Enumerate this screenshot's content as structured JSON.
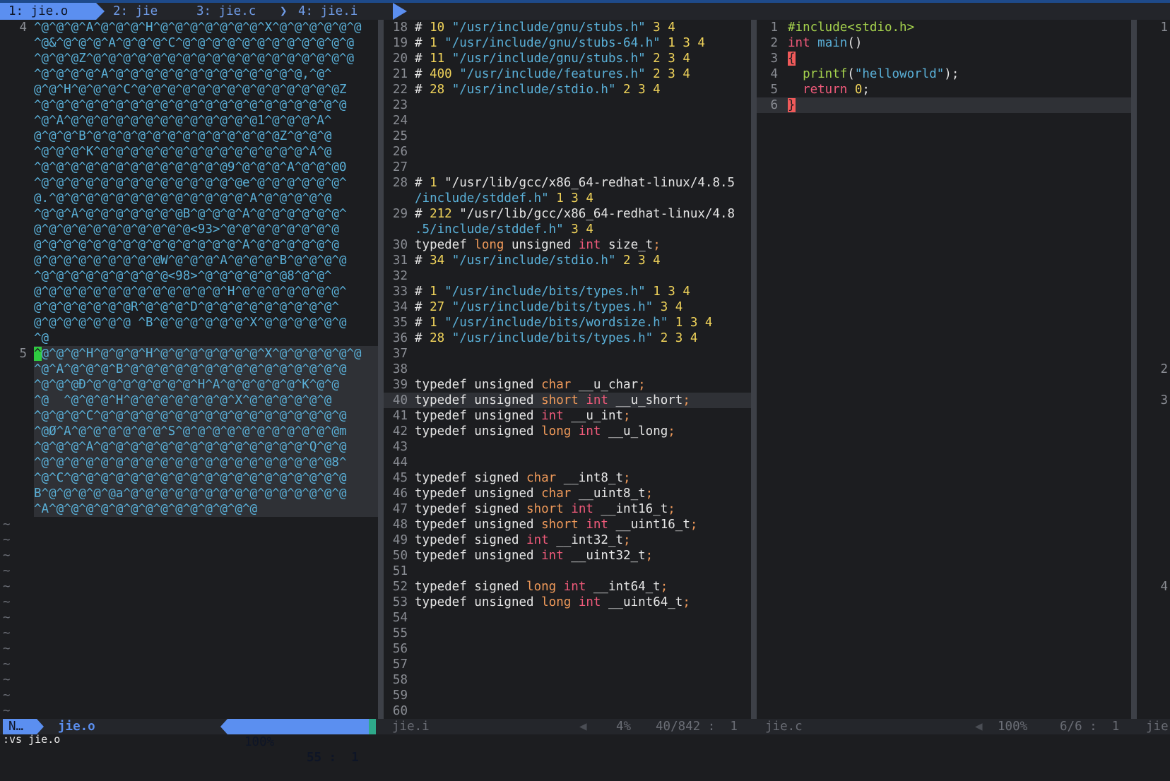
{
  "tabline": {
    "tabs": [
      {
        "label": "1: jie.o",
        "active": true
      },
      {
        "label": "2: jie",
        "active": false
      },
      {
        "label": "3: jie.c",
        "active": false
      },
      {
        "label": "4: jie.i",
        "active": false
      }
    ]
  },
  "pane_left": {
    "filename": "jie.o",
    "line4_num": "4",
    "line5_num": "5",
    "line4_text": [
      "^@^@^@^A^@^@^@^H^@^@^@^@^@^@^@^X^@^@^@^@^@^@",
      "^@&^@^@^@^A^@^@^@^C^@^@^@^@^@^@^@^@^@^@^@^@",
      "^@^@^@Z^@^@^@^@^@^@^@^@^@^@^@^@^@^@^@^@^@^@",
      "^@^@^@^@^A^@^@^@^@^@^@^@^@^@^@^@^@^@,^@^",
      "@^@^H^@^@^@^C^@^@^@^@^@^@^@^@^@^@^@^@^@^@Z",
      "^@^@^@^@^@^@^@^@^@^@^@^@^@^@^@^@^@^@^@^@^@",
      "^@^A^@^@^@^@^@^@^@^@^@^@^@^@^@1^@^@^@^A^",
      "@^@^@^B^@^@^@^@^@^@^@^@^@^@^@^@^@Z^@^@^@",
      "^@^@^@^K^@^@^@^@^@^@^@^@^@^@^@^@^@^@^A^@",
      "^@^@^@^@^@^@^@^@^@^@^@^@^@9^@^@^@^A^@^@^@0",
      "^@^@^@^@^@^@^@^@^@^@^@^@^@^@e^@^@^@^@^@^@^",
      "@.^@^@^@^@^@^@^@^@^@^@^@^@^@^A^@^@^@^@^@",
      "^@^@^A^@^@^@^@^@^@^@B^@^@^@^A^@^@^@^@^@^@^",
      "@^@^@^@^@^@^@^@^@^@^@<93>^@^@^@^@^@^@^@^@",
      "@^@^@^@^@^@^@^@^@^@^@^@^@^@^A^@^@^@^@^@^@",
      "@^@^@^@^@^@^@^@^@W^@^@^@^A^@^@^@^B^@^@^@^@",
      "^@^@^@^@^@^@^@^@^@<98>^@^@^@^@^@^@8^@^@^",
      "@^@^@^@^@^@^@^@^@^@^@^@^@^H^@^@^@^@^@^@^@^",
      "@^@^@^@^@^@^@R^@^@^@^D^@^@^@^@^@^@^@^@^@^",
      "@^@^@^@^@^@^@ ^B^@^@^@^@^@^@^X^@^@^@^@^@^@",
      "^@"
    ],
    "line5_text": [
      "^@^@^@^H^@^@^@^H^@^@^@^@^@^@^@^X^@^@^@^@^@^@",
      "^@^A^@^@^@^B^@^@^@^@^@^@^@^@^@^@^@^@^@^@^@",
      "^@^@^@Ð^@^@^@^@^@^@^@^H^A^@^@^@^@^@^K^@^@",
      "^@  ^@^@^@^H^@^@^@^@^@^@^@^X^@^@^@^@^@^@",
      "^@^@^@^C^@^@^@^@^@^@^@^@^@^@^@^@^@^@^@^@^@",
      "^@Ø^A^@^@^@^@^@^@^S^@^@^@^@^@^@^@^@^@^@^@m",
      "^@^@^@^A^@^@^@^@^@^@^@^@^@^@^@^@^@^@^Q^@^@",
      "^@^@^@^@^@^@^@^@^@^@^@^@^@^@^@^@^@^@^@^@8^",
      "^@^C^@^@^@^@^@^@^@^@^@^@^@^@^@^@^@^@^@^@^@",
      "B^@^@^@^@^@a^@^@^@^@^@^@^@^@^@^@^@^@^@^@^@",
      "^A^@^@^@^@^@^@^@^@^@^@^@^@^@^@"
    ],
    "tilde": "~"
  },
  "pane_mid": {
    "filename": "jie.i",
    "lines": [
      {
        "n": "18",
        "t": "# 10 \"/usr/include/gnu/stubs.h\" 3 4"
      },
      {
        "n": "19",
        "t": "# 1 \"/usr/include/gnu/stubs-64.h\" 1 3 4"
      },
      {
        "n": "20",
        "t": "# 11 \"/usr/include/gnu/stubs.h\" 2 3 4"
      },
      {
        "n": "21",
        "t": "# 400 \"/usr/include/features.h\" 2 3 4"
      },
      {
        "n": "22",
        "t": "# 28 \"/usr/include/stdio.h\" 2 3 4"
      },
      {
        "n": "23",
        "t": ""
      },
      {
        "n": "24",
        "t": ""
      },
      {
        "n": "25",
        "t": ""
      },
      {
        "n": "26",
        "t": ""
      },
      {
        "n": "27",
        "t": ""
      },
      {
        "n": "28",
        "t": "# 1 \"/usr/lib/gcc/x86_64-redhat-linux/4.8.5"
      },
      {
        "n": "",
        "t": "/include/stddef.h\" 1 3 4"
      },
      {
        "n": "29",
        "t": "# 212 \"/usr/lib/gcc/x86_64-redhat-linux/4.8"
      },
      {
        "n": "",
        "t": ".5/include/stddef.h\" 3 4"
      },
      {
        "n": "30",
        "t": "typedef long unsigned int size_t;"
      },
      {
        "n": "31",
        "t": "# 34 \"/usr/include/stdio.h\" 2 3 4"
      },
      {
        "n": "32",
        "t": ""
      },
      {
        "n": "33",
        "t": "# 1 \"/usr/include/bits/types.h\" 1 3 4"
      },
      {
        "n": "34",
        "t": "# 27 \"/usr/include/bits/types.h\" 3 4"
      },
      {
        "n": "35",
        "t": "# 1 \"/usr/include/bits/wordsize.h\" 1 3 4"
      },
      {
        "n": "36",
        "t": "# 28 \"/usr/include/bits/types.h\" 2 3 4"
      },
      {
        "n": "37",
        "t": ""
      },
      {
        "n": "38",
        "t": ""
      },
      {
        "n": "39",
        "t": "typedef unsigned char __u_char;"
      },
      {
        "n": "40",
        "t": "typedef unsigned short int __u_short;"
      },
      {
        "n": "41",
        "t": "typedef unsigned int __u_int;"
      },
      {
        "n": "42",
        "t": "typedef unsigned long int __u_long;"
      },
      {
        "n": "43",
        "t": ""
      },
      {
        "n": "44",
        "t": ""
      },
      {
        "n": "45",
        "t": "typedef signed char __int8_t;"
      },
      {
        "n": "46",
        "t": "typedef unsigned char __uint8_t;"
      },
      {
        "n": "47",
        "t": "typedef signed short int __int16_t;"
      },
      {
        "n": "48",
        "t": "typedef unsigned short int __uint16_t;"
      },
      {
        "n": "49",
        "t": "typedef signed int __int32_t;"
      },
      {
        "n": "50",
        "t": "typedef unsigned int __uint32_t;"
      },
      {
        "n": "51",
        "t": ""
      },
      {
        "n": "52",
        "t": "typedef signed long int __int64_t;"
      },
      {
        "n": "53",
        "t": "typedef unsigned long int __uint64_t;"
      },
      {
        "n": "54",
        "t": ""
      },
      {
        "n": "55",
        "t": ""
      },
      {
        "n": "56",
        "t": ""
      },
      {
        "n": "57",
        "t": ""
      },
      {
        "n": "58",
        "t": ""
      },
      {
        "n": "59",
        "t": ""
      },
      {
        "n": "60",
        "t": ""
      }
    ]
  },
  "pane_right": {
    "filename": "jie.c",
    "lines": [
      {
        "n": "1",
        "t": "#include<stdio.h>"
      },
      {
        "n": "2",
        "t": "int main()"
      },
      {
        "n": "3",
        "t": "{"
      },
      {
        "n": "4",
        "t": "  printf(\"helloworld\");"
      },
      {
        "n": "5",
        "t": "  return 0;"
      },
      {
        "n": "6",
        "t": "}"
      }
    ]
  },
  "pane_far": {
    "numbers": [
      {
        "n": "1",
        "row": 0
      },
      {
        "n": "2",
        "row": 22
      },
      {
        "n": "3",
        "row": 24
      },
      {
        "n": "4",
        "row": 36
      }
    ],
    "filename": "jie"
  },
  "statusline": {
    "mode": "N…",
    "left_file": "jie.o",
    "left_pct": "100%",
    "left_pos": "55 :  1",
    "mid_file": "jie.i",
    "mid_pct": "4%",
    "mid_pos": "40/842 :  1",
    "right_file": "jie.c",
    "right_pct": "100%",
    "right_pos": "6/6 :  1",
    "far_file": "jie"
  },
  "cmdline": ":vs jie.o",
  "colors": {
    "accent": "#5b8ff0",
    "bg": "#1c1d20",
    "cyan": "#5ab0d8",
    "yellow": "#f0d35a",
    "pink": "#f05a7a",
    "orange": "#f09a5a",
    "green": "#a6d34d",
    "cursor": "#2ecc40"
  }
}
